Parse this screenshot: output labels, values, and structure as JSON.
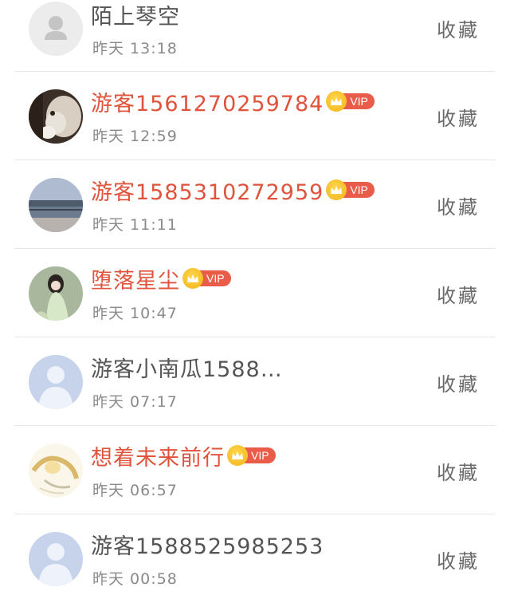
{
  "items": [
    {
      "name": "陌上琴空",
      "time": "昨天 13:18",
      "vip": false,
      "avatar": "default-avatar-gray"
    },
    {
      "name": "游客1561270259784",
      "time": "昨天 12:59",
      "vip": true,
      "avatar": "cat-photo-avatar"
    },
    {
      "name": "游客1585310272959",
      "time": "昨天 11:11",
      "vip": true,
      "avatar": "lake-photo-avatar"
    },
    {
      "name": "堕落星尘",
      "time": "昨天 10:47",
      "vip": true,
      "avatar": "anime-girl-avatar"
    },
    {
      "name": "游客小南瓜1588…",
      "time": "昨天 07:17",
      "vip": false,
      "avatar": "default-avatar-blue"
    },
    {
      "name": "想着未来前行",
      "time": "昨天 06:57",
      "vip": true,
      "avatar": "anime-sketch-avatar"
    },
    {
      "name": "游客1588525985253",
      "time": "昨天 00:58",
      "vip": false,
      "avatar": "default-avatar-blue"
    }
  ],
  "vip_label": "VIP",
  "favorite_label": "收藏",
  "colors": {
    "vip_name": "#e0533c",
    "normal_name": "#555555",
    "vip_badge": "#e95c4a",
    "crown": "#f2b519"
  }
}
